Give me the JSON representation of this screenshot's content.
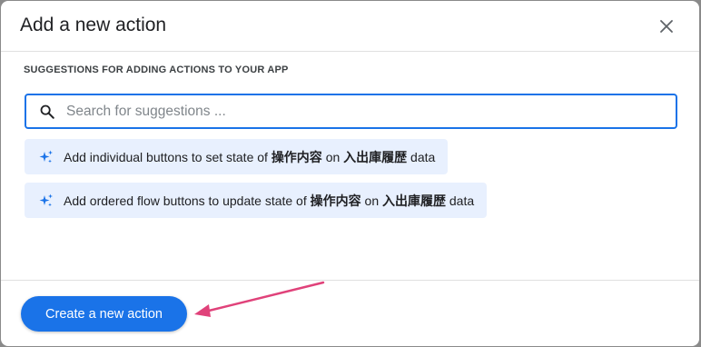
{
  "dialog": {
    "title": "Add a new action",
    "close_icon": "close-icon"
  },
  "suggestions_section": {
    "label": "SUGGESTIONS FOR ADDING ACTIONS TO YOUR APP",
    "search": {
      "placeholder": "Search for suggestions ...",
      "value": "",
      "icon": "search-icon"
    },
    "items": [
      {
        "icon": "sparkle-icon",
        "prefix": "Add individual buttons to set state of ",
        "column": "操作内容",
        "mid": " on ",
        "table": "入出庫履歴",
        "suffix": " data"
      },
      {
        "icon": "sparkle-icon",
        "prefix": "Add ordered flow buttons to update state of ",
        "column": "操作内容",
        "mid": " on ",
        "table": "入出庫履歴",
        "suffix": " data"
      }
    ]
  },
  "footer": {
    "create_button_label": "Create a new action"
  },
  "colors": {
    "accent": "#1a73e8",
    "suggestion_bg": "#e8f0fe",
    "annotation_arrow": "#e0427a"
  }
}
